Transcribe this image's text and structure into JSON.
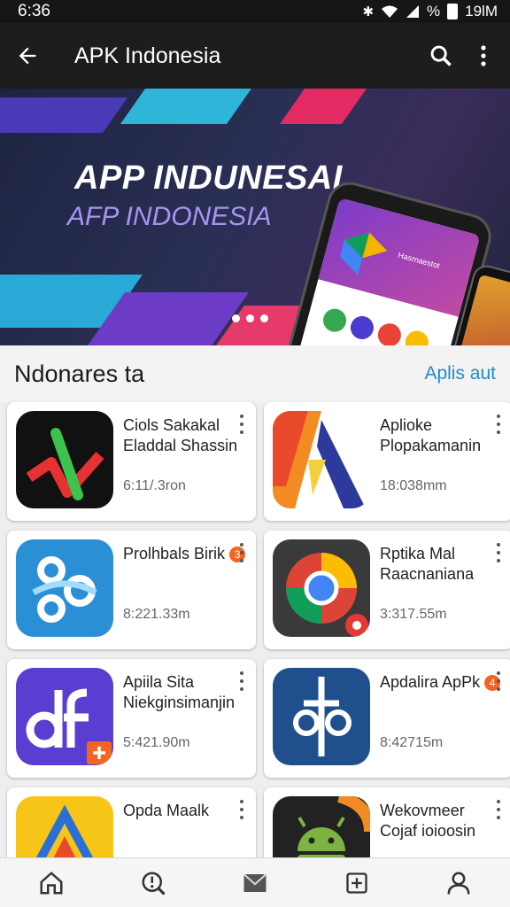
{
  "status_bar": {
    "time": "6:36",
    "battery_text": "%",
    "right_time": "19lM"
  },
  "app_bar": {
    "title": "APK Indonesia"
  },
  "banner": {
    "headline": "APP INDUNESAI",
    "subheadline": "AFP INDONESIA",
    "phone_text": "Hasrnaestot"
  },
  "section": {
    "title": "Ndonares ta",
    "link": "Aplis aut"
  },
  "apps": [
    {
      "name": "Ciols Sakakal Eladdal Shassin",
      "meta": "6:11/.3ron",
      "badge": ""
    },
    {
      "name": "Aplioke Plopakamanin",
      "meta": "18:038mm",
      "badge": ""
    },
    {
      "name": "Prolhbals Birik",
      "meta": "8:221.33m",
      "badge": "3"
    },
    {
      "name": "Rptika Mal Raacnaniana",
      "meta": "3:317.55m",
      "badge": ""
    },
    {
      "name": "Apiila Sita Niekginsimanjin",
      "meta": "5:421.90m",
      "badge": ""
    },
    {
      "name": "Apdalira ApPk",
      "meta": "8:42715m",
      "badge": "4"
    },
    {
      "name": "Opda Maalk",
      "meta": "",
      "badge": ""
    },
    {
      "name": "Wekovmeer Cojaf ioioosin",
      "meta": "",
      "badge": ""
    }
  ],
  "icons": {
    "back": "arrow-left-icon",
    "search": "search-icon",
    "more": "more-vert-icon",
    "nav": [
      "home-icon",
      "explore-icon",
      "mail-icon",
      "add-box-icon",
      "profile-icon"
    ]
  },
  "colors": {
    "app_bar": "#1d1d1d",
    "link": "#1e8acb",
    "badge": "#f26522"
  }
}
